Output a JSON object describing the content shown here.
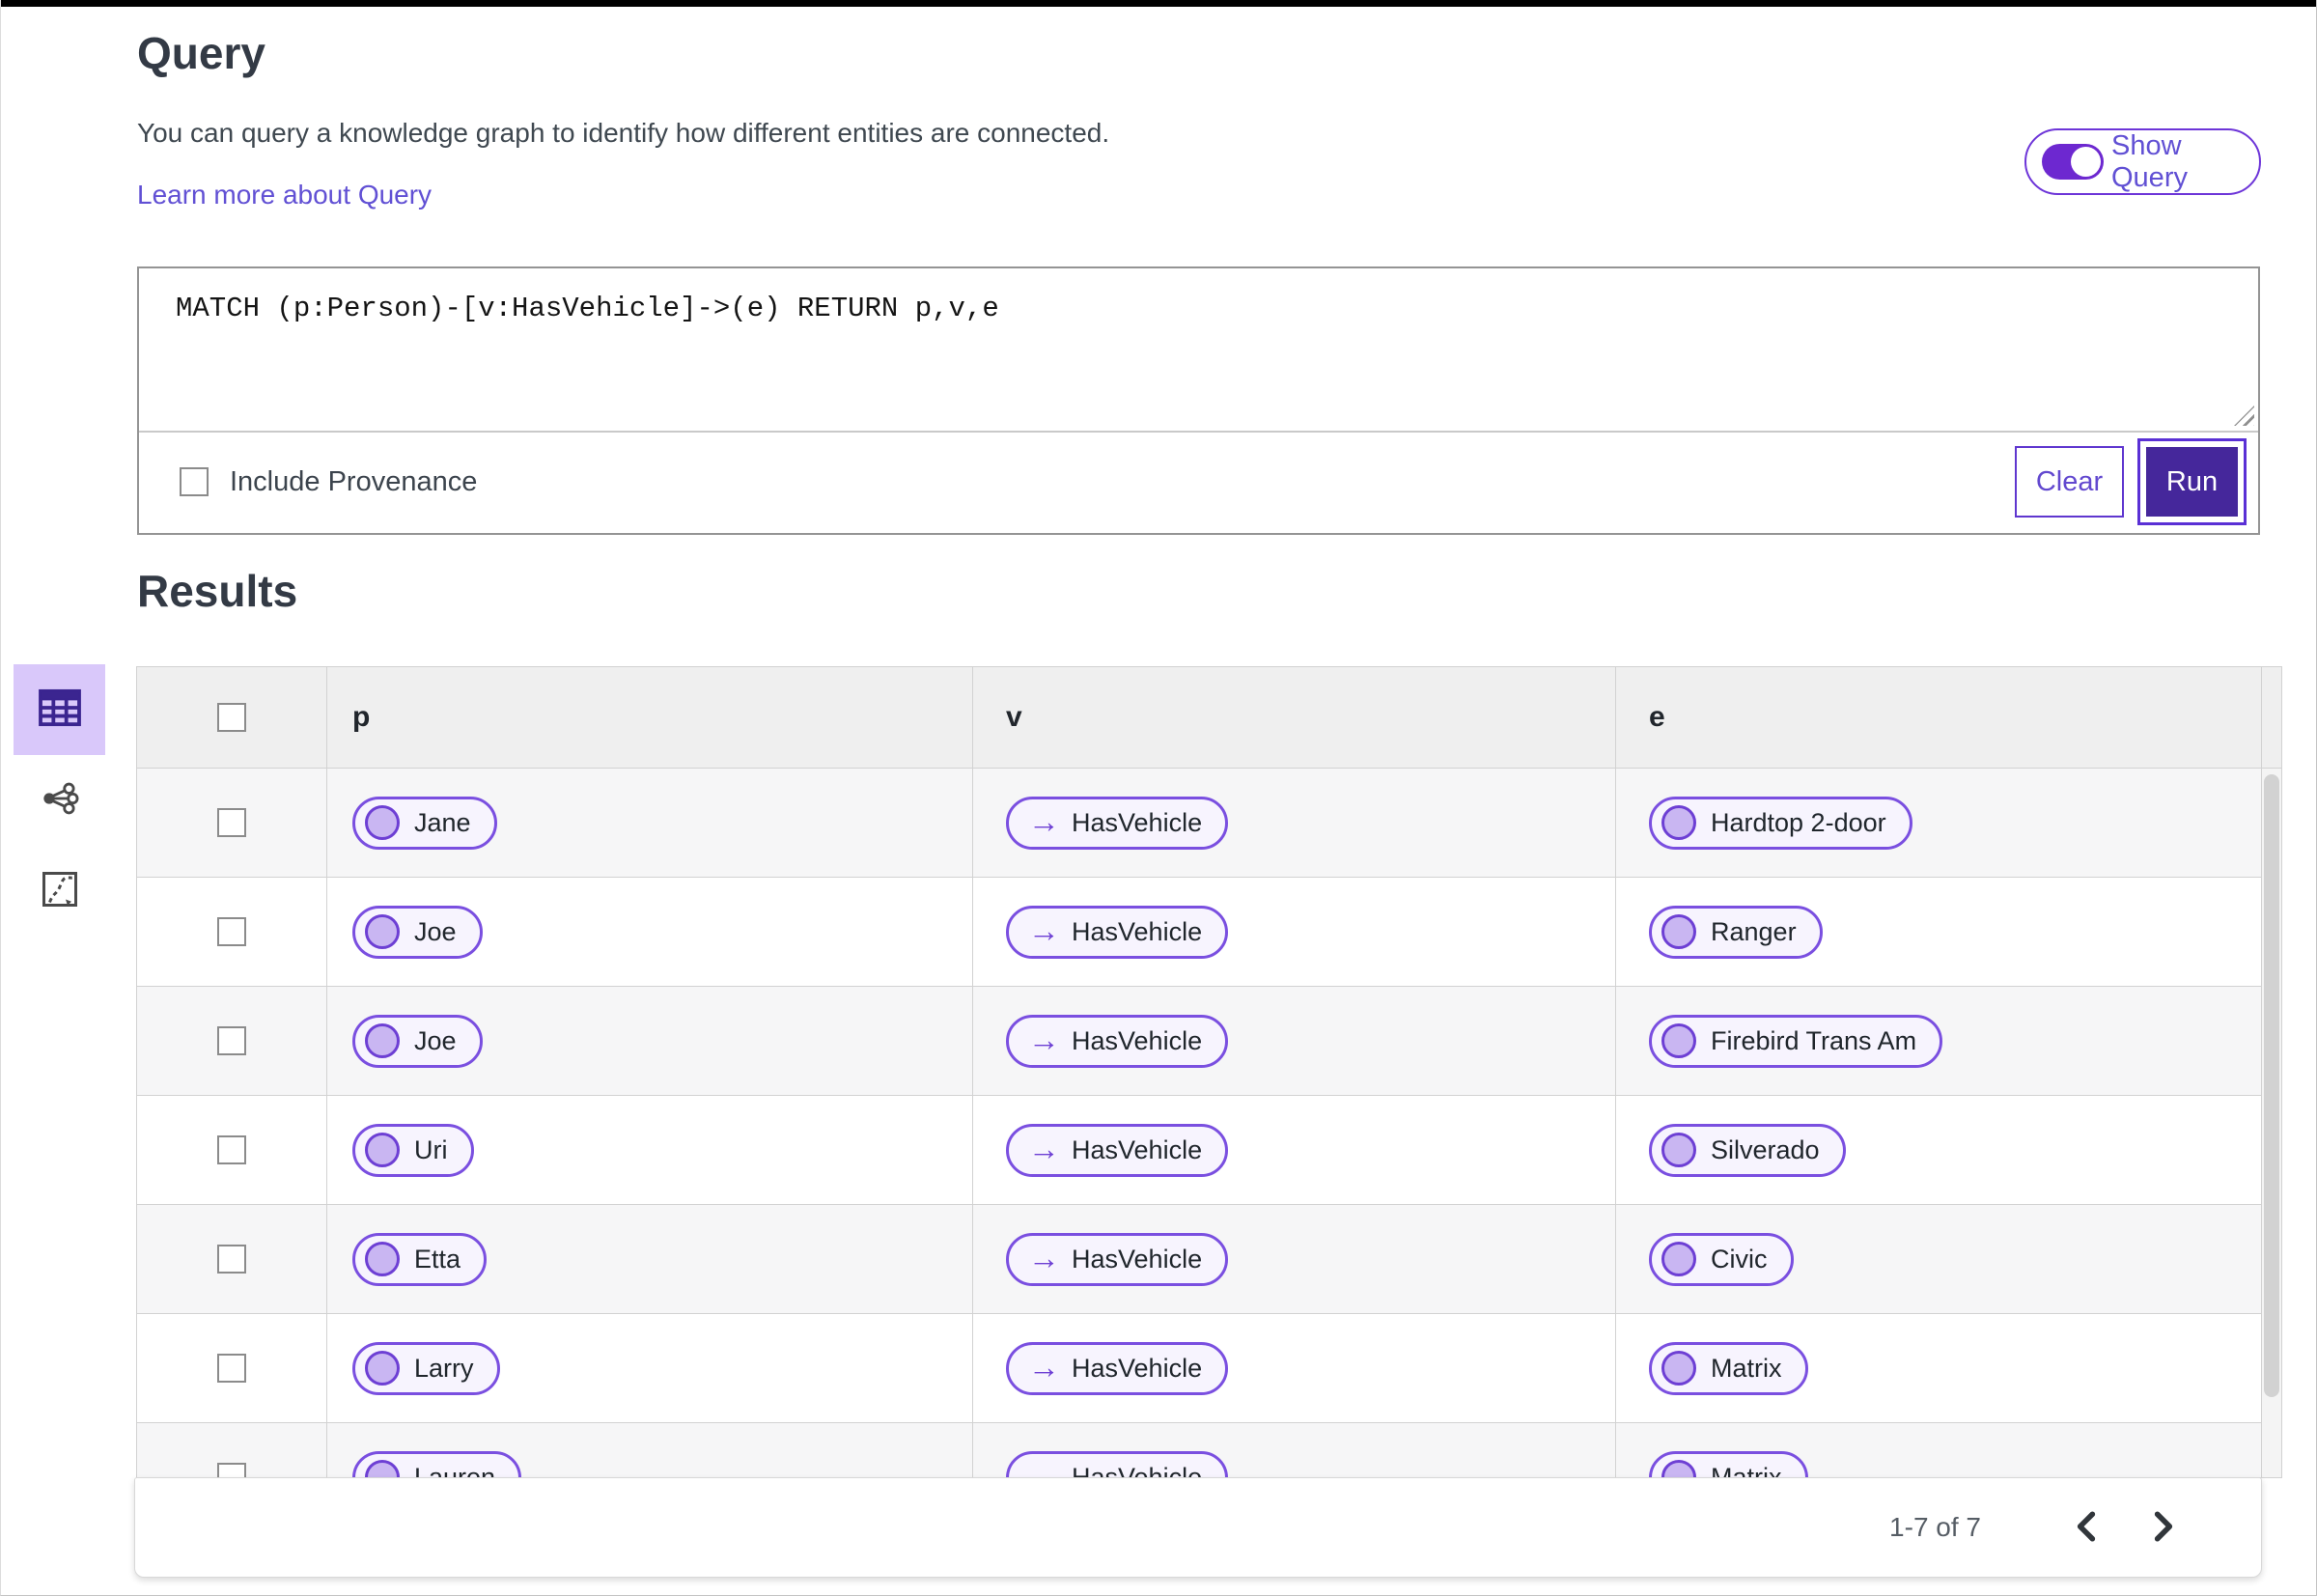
{
  "page": {
    "title": "Query",
    "description": "You can query a knowledge graph to identify how different entities are connected.",
    "learn_more_label": "Learn more about Query"
  },
  "query_panel": {
    "show_query_label": "Show Query",
    "show_query_on": true,
    "query_text": "MATCH (p:Person)-[v:HasVehicle]->(e) RETURN p,v,e",
    "include_provenance_label": "Include Provenance",
    "include_provenance_checked": false,
    "clear_label": "Clear",
    "run_label": "Run"
  },
  "results": {
    "title": "Results",
    "columns": [
      "p",
      "v",
      "e"
    ],
    "arrow_glyph": "→",
    "rows": [
      {
        "p": "Jane",
        "v": "HasVehicle",
        "e": "Hardtop 2-door"
      },
      {
        "p": "Joe",
        "v": "HasVehicle",
        "e": "Ranger"
      },
      {
        "p": "Joe",
        "v": "HasVehicle",
        "e": "Firebird Trans Am"
      },
      {
        "p": "Uri",
        "v": "HasVehicle",
        "e": "Silverado"
      },
      {
        "p": "Etta",
        "v": "HasVehicle",
        "e": "Civic"
      },
      {
        "p": "Larry",
        "v": "HasVehicle",
        "e": "Matrix"
      },
      {
        "p": "Lauren",
        "v": "HasVehicle",
        "e": "Matrix"
      }
    ],
    "pagination": {
      "range_label": "1-7 of 7"
    }
  },
  "view_switcher": {
    "items": [
      {
        "icon": "table-view-icon",
        "selected": true
      },
      {
        "icon": "graph-view-icon",
        "selected": false
      },
      {
        "icon": "chart-view-icon",
        "selected": false
      }
    ]
  },
  "colors": {
    "accent_purple": "#6d28d0",
    "pill_border": "#7a4fe0",
    "pill_background": "#f7f4fe",
    "node_fill": "#c9b6f2",
    "run_button_fill": "#45279b",
    "selected_view_background": "#d9c8fa",
    "header_row_background": "#efefef",
    "stripe_row_background": "#f6f6f7"
  }
}
